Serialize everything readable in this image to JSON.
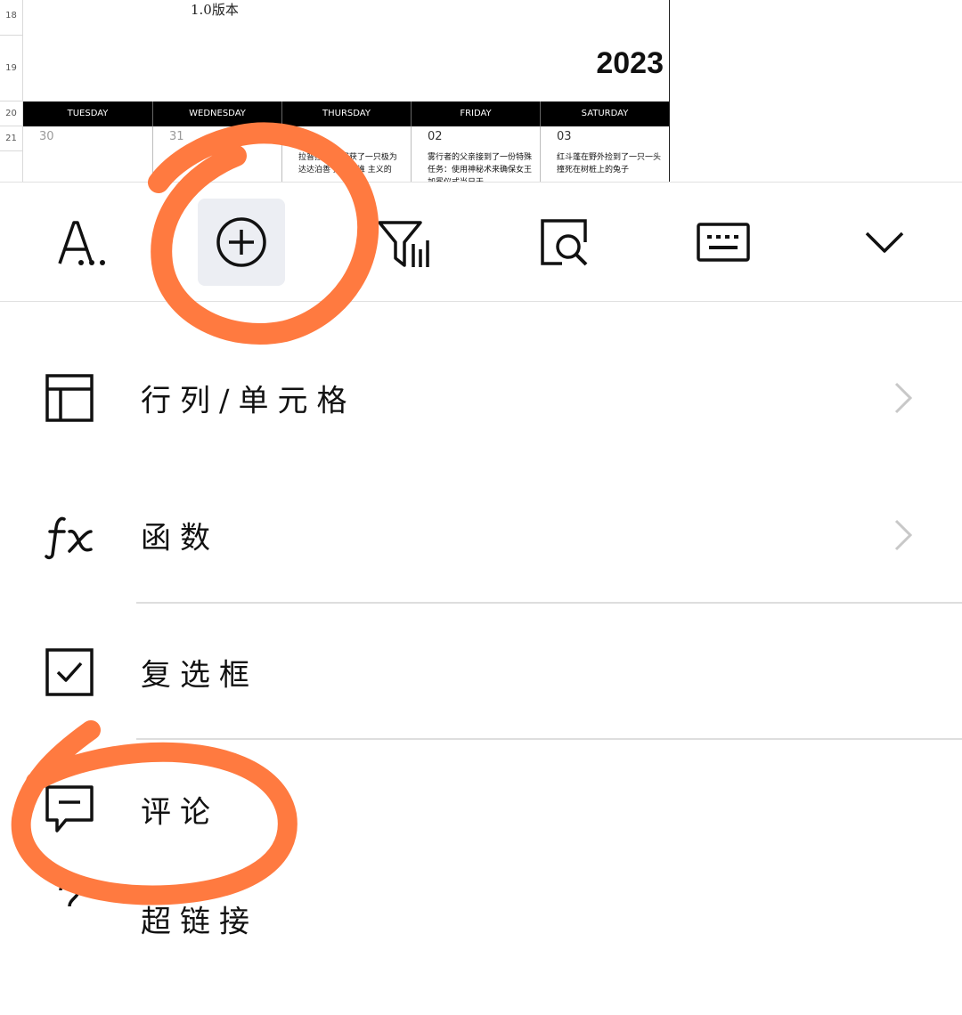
{
  "sheet": {
    "row_numbers": [
      "18",
      "19",
      "20",
      "21"
    ],
    "version_label": "1.0版本",
    "year": "2023",
    "days": [
      "TUESDAY",
      "WEDNESDAY",
      "THURSDAY",
      "FRIDAY",
      "SATURDAY"
    ],
    "dates": [
      "30",
      "31",
      "",
      "02",
      "03"
    ],
    "events": [
      "",
      "",
      "拉普拉 中心捕获了一只极为 达达泊善 并宣称谁 主义的",
      "雾行者的父亲接到了一份特殊任务：使用神秘术来确保女王加冕仪式当日天",
      "红斗蓬在野外捡到了一只一头撞死在树桩上的兔子"
    ]
  },
  "toolbar": {
    "tools": [
      {
        "name": "text-format",
        "icon": "text-format-icon"
      },
      {
        "name": "insert",
        "icon": "plus-circle-icon"
      },
      {
        "name": "filter-sort",
        "icon": "filter-sort-icon"
      },
      {
        "name": "find",
        "icon": "find-icon"
      },
      {
        "name": "keyboard",
        "icon": "keyboard-icon"
      },
      {
        "name": "collapse",
        "icon": "chevron-down-icon"
      }
    ]
  },
  "menu": {
    "items": [
      {
        "label": "行列/单元格",
        "icon": "table-icon",
        "has_submenu": true
      },
      {
        "label": "函数",
        "icon": "function-fx-icon",
        "has_submenu": true
      },
      {
        "label": "复选框",
        "icon": "checkbox-icon",
        "has_submenu": false
      },
      {
        "label": "评论",
        "icon": "comment-icon",
        "has_submenu": false
      },
      {
        "label": "超链接",
        "icon": "link-icon",
        "has_submenu": false
      }
    ]
  },
  "colors": {
    "annotation": "#ff7a40",
    "active_tool_bg": "#eceef3",
    "header_bg": "#000000"
  }
}
